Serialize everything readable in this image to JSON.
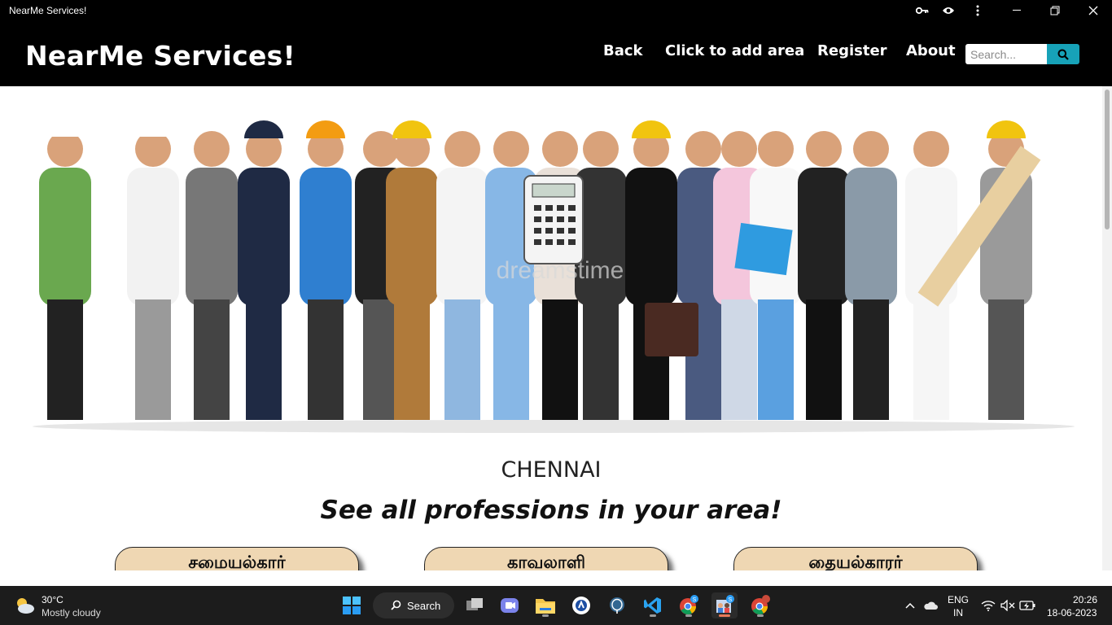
{
  "window": {
    "title": "NearMe Services!"
  },
  "navbar": {
    "brand": "NearMe Services!",
    "links": [
      "Back",
      "Click to add area",
      "Register",
      "About"
    ],
    "search_placeholder": "Search..."
  },
  "main": {
    "city": "CHENNAI",
    "tagline": "See all professions in your area!",
    "professions": [
      "சமையல்கார்",
      "காவலாளி",
      "தையல்காரர்"
    ],
    "banner_watermark": "dreamstime"
  },
  "taskbar": {
    "weather_temp": "30°C",
    "weather_desc": "Mostly cloudy",
    "search_label": "Search",
    "language": "ENG",
    "region": "IN",
    "time": "20:26",
    "date": "18-06-2023"
  },
  "colors": {
    "nav_bg": "#000000",
    "accent": "#17a2b8",
    "button_bg": "#efd7b3",
    "taskbar_bg": "#1c1c1c"
  }
}
